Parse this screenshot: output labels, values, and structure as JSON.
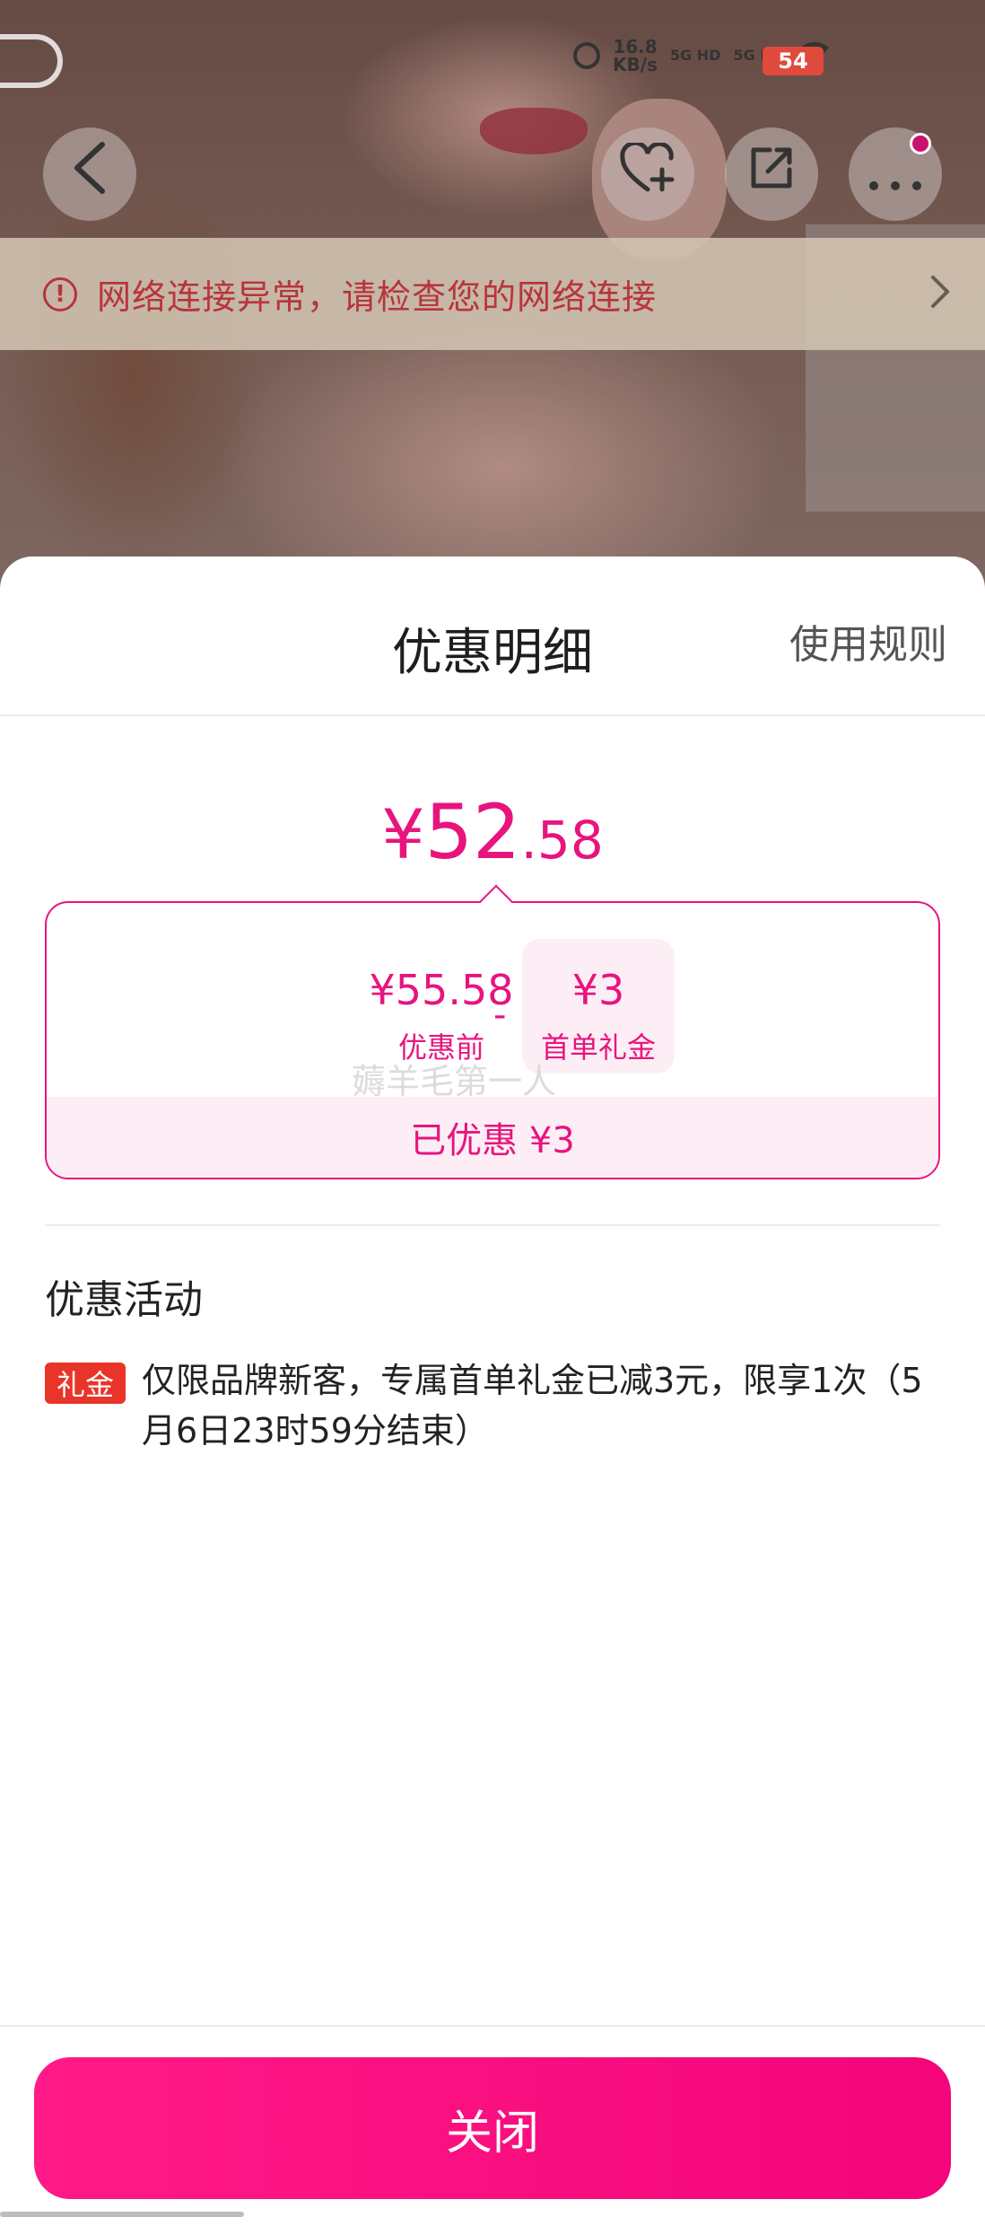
{
  "status_bar": {
    "net_speed_value": "16.8",
    "net_speed_unit": "KB/s",
    "signal_1": "5G HD",
    "signal_2": "5G HD",
    "battery": "54"
  },
  "banner": {
    "message": "网络连接异常，请检查您的网络连接"
  },
  "sheet": {
    "title": "优惠明细",
    "rules_link": "使用规则",
    "final_price": {
      "yen": "¥",
      "integer": "52",
      "decimal": ".58"
    },
    "calc": {
      "original_value": "¥55.58",
      "original_label": "优惠前",
      "operator": "-",
      "gift_value": "¥3",
      "gift_label": "首单礼金",
      "ghost_text": "薅羊毛第一人",
      "saved": "已优惠 ¥3"
    },
    "activity": {
      "section_title": "优惠活动",
      "tag": "礼金",
      "description": "仅限品牌新客，专属首单礼金已减3元，限享1次（5月6日23时59分结束）"
    },
    "close_button": "关闭"
  },
  "colors": {
    "accent": "#e8147e",
    "button": "#ff1a87",
    "tag": "#e9342a",
    "warning": "#b8343c"
  },
  "icons": [
    "back-icon",
    "favorite-add-icon",
    "share-icon",
    "more-icon",
    "warning-icon",
    "chevron-right-icon",
    "alarm-icon",
    "wifi-icon"
  ]
}
